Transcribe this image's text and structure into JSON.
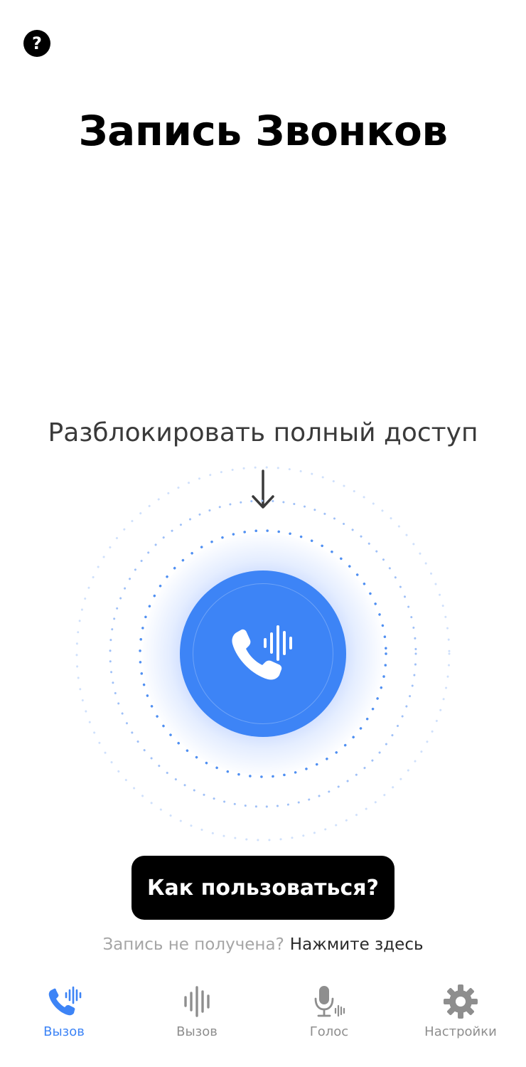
{
  "header": {
    "help_icon": "question-mark-icon",
    "help_glyph": "?",
    "title": "Запись Звонков"
  },
  "main": {
    "unlock_label": "Разблокировать полный доступ",
    "arrow_icon": "arrow-down-icon",
    "record_icon": "phone-waveform-icon",
    "how_to_button": "Как пользоваться?",
    "not_received_text": "Запись не получена?",
    "tap_here_link": "Нажмите здесь"
  },
  "tabbar": {
    "tabs": [
      {
        "label": "Вызов",
        "icon": "phone-waveform-icon",
        "active": true
      },
      {
        "label": "Вызов",
        "icon": "waveform-icon",
        "active": false
      },
      {
        "label": "Голос",
        "icon": "microphone-icon",
        "active": false
      },
      {
        "label": "Настройки",
        "icon": "gear-icon",
        "active": false
      }
    ]
  },
  "colors": {
    "accent": "#3d84f6",
    "inactive": "#8e8e8e",
    "button_bg": "#000000"
  }
}
